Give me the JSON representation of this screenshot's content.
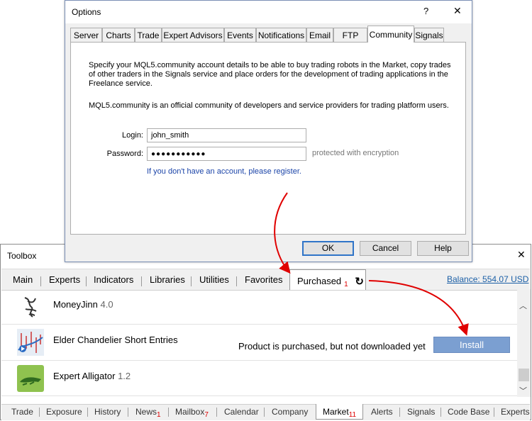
{
  "options": {
    "title": "Options",
    "help_label": "?",
    "close_label": "✕",
    "tabs": [
      "Server",
      "Charts",
      "Trade",
      "Expert Advisors",
      "Events",
      "Notifications",
      "Email",
      "FTP",
      "Community",
      "Signals"
    ],
    "active_tab": "Community",
    "description1": "Specify your MQL5.community account details to be able to buy trading robots in the Market, copy trades of other traders in the Signals service and place orders for the development of trading applications in the Freelance service.",
    "description2": "MQL5.community is an official community of developers and service providers for trading platform users.",
    "login_label": "Login:",
    "login_value": "john_smith",
    "password_label": "Password:",
    "password_value": "●●●●●●●●●●●",
    "encryption_note": "protected with encryption",
    "register_link": "If you don't have an account, please register.",
    "ok_label": "OK",
    "cancel_label": "Cancel",
    "help_button_label": "Help"
  },
  "toolbox": {
    "title": "Toolbox",
    "close_label": "✕",
    "tabs": [
      "Main",
      "Experts",
      "Indicators",
      "Libraries",
      "Utilities",
      "Favorites",
      "Purchased"
    ],
    "purchased_badge": "1",
    "refresh_icon": "↻",
    "balance": "Balance: 554.07 USD",
    "products": [
      {
        "name": "MoneyJinn",
        "version": "4.0",
        "icon": "moneyjinn-logo-icon"
      },
      {
        "name": "Elder Chandelier Short Entries",
        "version": "",
        "icon": "chart-indicator-icon"
      },
      {
        "name": "Expert Alligator",
        "version": "1.2",
        "icon": "alligator-icon"
      }
    ],
    "status_text": "Product is purchased, but not downloaded yet",
    "install_label": "Install",
    "bottom_tabs": [
      {
        "label": "Trade",
        "badge": ""
      },
      {
        "label": "Exposure",
        "badge": ""
      },
      {
        "label": "History",
        "badge": ""
      },
      {
        "label": "News",
        "badge": "1"
      },
      {
        "label": "Mailbox",
        "badge": "7"
      },
      {
        "label": "Calendar",
        "badge": ""
      },
      {
        "label": "Company",
        "badge": ""
      },
      {
        "label": "Market",
        "badge": "11"
      },
      {
        "label": "Alerts",
        "badge": ""
      },
      {
        "label": "Signals",
        "badge": ""
      },
      {
        "label": "Code Base",
        "badge": ""
      },
      {
        "label": "Experts",
        "badge": ""
      }
    ],
    "active_bottom_tab": "Market"
  },
  "colors": {
    "install_button": "#7b9fd1",
    "link": "#1b44a8",
    "badge": "#dd0000",
    "arrow": "#e00000"
  }
}
